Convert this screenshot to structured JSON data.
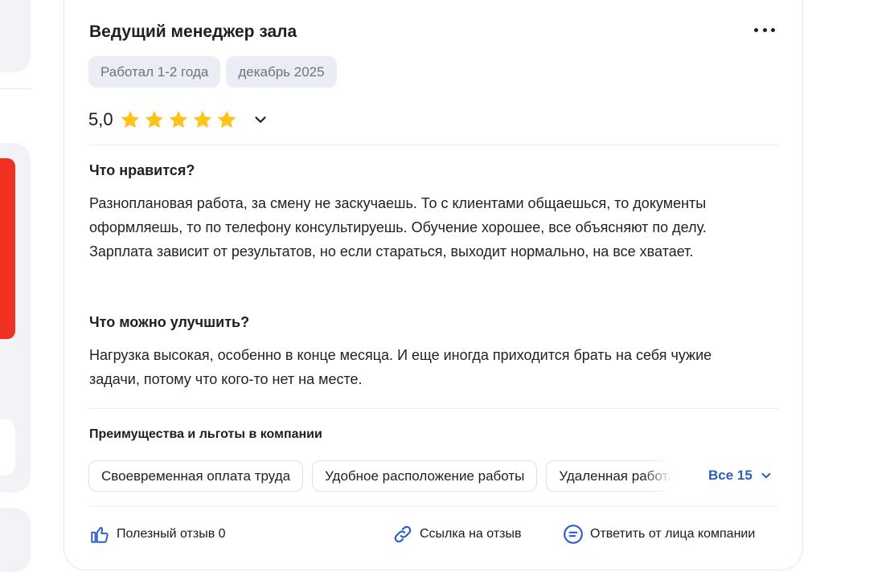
{
  "review": {
    "title": "Ведущий менеджер зала",
    "tags": [
      "Работал 1-2 года",
      "декабрь 2025"
    ],
    "rating": {
      "value_text": "5,0",
      "stars": 5,
      "max": 5
    },
    "likes": {
      "heading": "Что нравится?",
      "text": "Разноплановая работа, за смену не заскучаешь. То с клиентами общаешься, то документы оформляешь, то по телефону консультируешь. Обучение хорошее, все объясняют по делу. Зарплата зависит от результатов, но если стараться, выходит нормально, на все хватает."
    },
    "improve": {
      "heading": "Что можно улучшить?",
      "text": "Нагрузка высокая, особенно в конце месяца. И еще иногда приходится брать на себя чужие задачи, потому что кого-то нет на месте."
    },
    "benefits": {
      "heading": "Преимущества и льготы в компании",
      "items": [
        "Своевременная оплата труда",
        "Удобное расположение работы",
        "Удаленная работа"
      ],
      "all_label": "Все 15"
    },
    "actions": {
      "useful": "Полезный отзыв 0",
      "link": "Ссылка на отзыв",
      "reply": "Ответить от лица компании"
    }
  },
  "icons": {
    "more": "more-horizontal-icon",
    "star": "star-icon",
    "expand": "chevron-down-icon",
    "useful": "thumbs-up-icon",
    "link": "link-icon",
    "reply": "chat-bubble-icon"
  },
  "colors": {
    "star": "#fcc419",
    "link": "#2c5ec5",
    "tag_bg": "#eaedf3",
    "tag_text": "#6b7384",
    "accent_red": "#f03021"
  }
}
